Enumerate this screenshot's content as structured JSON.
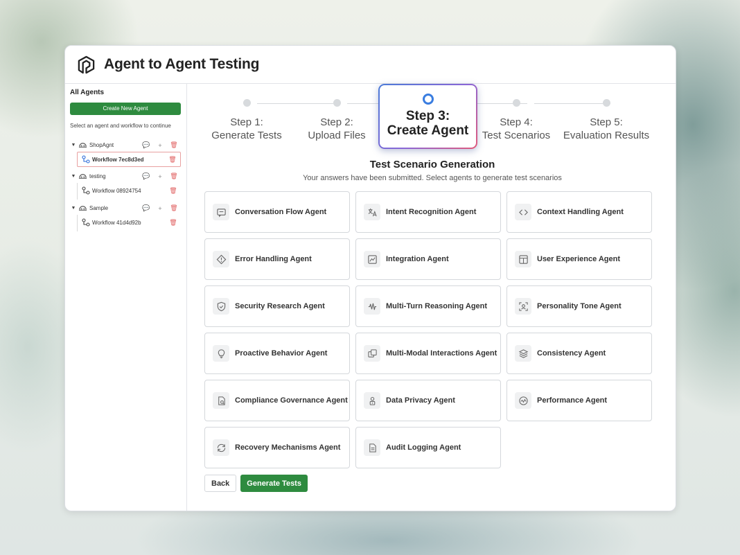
{
  "app": {
    "title": "Agent to Agent Testing"
  },
  "sidebar": {
    "heading": "All Agents",
    "create_button": "Create New Agent",
    "hint": "Select an agent and workflow to continue",
    "agents": [
      {
        "name": "ShopAgnt",
        "workflow": "Workflow 7ec8d3ed"
      },
      {
        "name": "testing",
        "workflow": "Workflow 08924754"
      },
      {
        "name": "Sample",
        "workflow": "Workflow 41d4d92b"
      }
    ]
  },
  "stepper": {
    "steps": [
      {
        "num": "Step 1:",
        "label": "Generate Tests"
      },
      {
        "num": "Step 2:",
        "label": "Upload Files"
      },
      {
        "num": "Step 3:",
        "label": "Create Agent"
      },
      {
        "num": "Step 4:",
        "label": "Test Scenarios"
      },
      {
        "num": "Step 5:",
        "label": "Evaluation Results"
      }
    ],
    "active_index": 2
  },
  "section": {
    "title": "Test Scenario Generation",
    "subtitle": "Your answers have been submitted. Select agents to generate test scenarios"
  },
  "agent_cards": [
    {
      "label": "Conversation Flow Agent",
      "icon": "chat-icon"
    },
    {
      "label": "Intent Recognition Agent",
      "icon": "translate-icon"
    },
    {
      "label": "Context Handling Agent",
      "icon": "code-icon"
    },
    {
      "label": "Error Handling Agent",
      "icon": "diamond-alert-icon"
    },
    {
      "label": "Integration Agent",
      "icon": "image-chart-icon"
    },
    {
      "label": "User Experience Agent",
      "icon": "layout-icon"
    },
    {
      "label": "Security Research Agent",
      "icon": "shield-icon"
    },
    {
      "label": "Multi-Turn Reasoning Agent",
      "icon": "waveform-icon"
    },
    {
      "label": "Personality Tone Agent",
      "icon": "user-scan-icon"
    },
    {
      "label": "Proactive Behavior Agent",
      "icon": "lightbulb-icon"
    },
    {
      "label": "Multi-Modal Interactions Agent",
      "icon": "windows-icon"
    },
    {
      "label": "Consistency Agent",
      "icon": "layers-icon"
    },
    {
      "label": "Compliance Governance Agent",
      "icon": "file-check-icon"
    },
    {
      "label": "Data Privacy Agent",
      "icon": "user-lock-icon"
    },
    {
      "label": "Performance Agent",
      "icon": "gauge-icon"
    },
    {
      "label": "Recovery Mechanisms Agent",
      "icon": "refresh-icon"
    },
    {
      "label": "Audit Logging Agent",
      "icon": "document-icon"
    }
  ],
  "footer": {
    "back": "Back",
    "generate": "Generate Tests"
  }
}
